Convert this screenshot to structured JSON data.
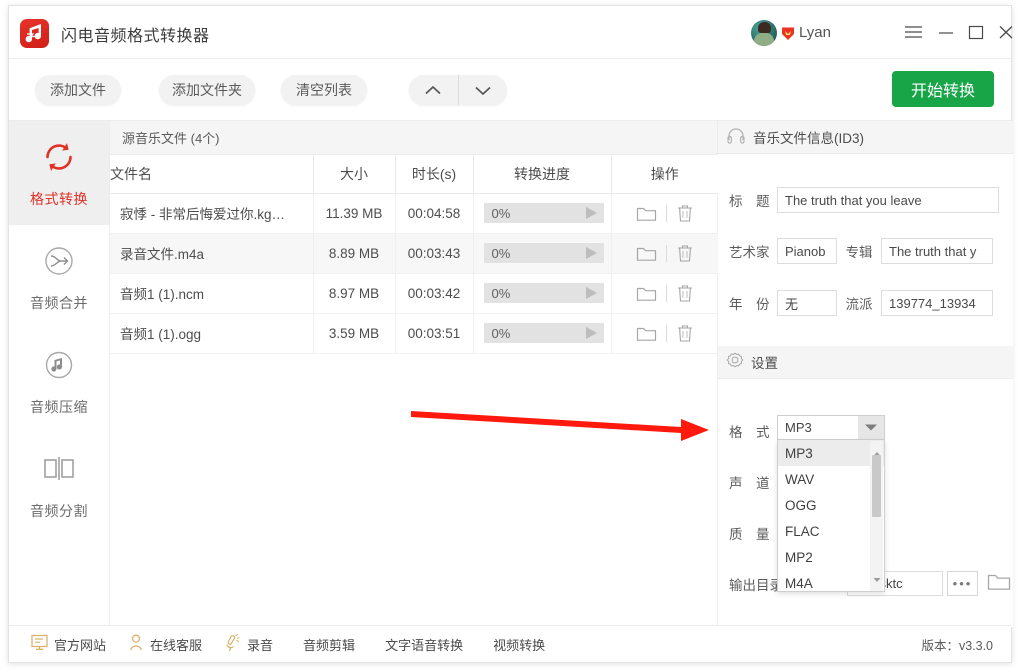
{
  "window": {
    "app_title": "闪电音频格式转换器",
    "app_icon": "music-note-icon",
    "user_name": "Lyan",
    "controls": {
      "menu": "menu-icon",
      "minimize": "minimize-icon",
      "maximize": "maximize-icon",
      "close": "close-icon"
    }
  },
  "toolbar": {
    "add_file": "添加文件",
    "add_folder": "添加文件夹",
    "clear_list": "清空列表",
    "move_up": "chevron-up-icon",
    "move_down": "chevron-down-icon",
    "start_convert": "开始转换",
    "start_convert_color": "#17a548"
  },
  "sidebar": {
    "items": [
      {
        "label": "格式转换",
        "icon": "refresh-circle-icon",
        "active": true
      },
      {
        "label": "音频合并",
        "icon": "merge-icon",
        "active": false
      },
      {
        "label": "音频压缩",
        "icon": "compress-note-icon",
        "active": false
      },
      {
        "label": "音频分割",
        "icon": "split-icon",
        "active": false
      }
    ],
    "active_color": "#e03127"
  },
  "filelist": {
    "header": "源音乐文件 (4个)",
    "columns": [
      "文件名",
      "大小",
      "时长(s)",
      "转换进度",
      "操作"
    ],
    "rows": [
      {
        "name": "寂悸 - 非常后悔爱过你.kg…",
        "size": "11.39 MB",
        "duration": "00:04:58",
        "progress": "0%"
      },
      {
        "name": "录音文件.m4a",
        "size": "8.89 MB",
        "duration": "00:03:43",
        "progress": "0%"
      },
      {
        "name": "音频1 (1).ncm",
        "size": "8.97 MB",
        "duration": "00:03:42",
        "progress": "0%"
      },
      {
        "name": "音频1 (1).ogg",
        "size": "3.59 MB",
        "duration": "00:03:51",
        "progress": "0%"
      }
    ],
    "row_action_icons": [
      "folder-icon",
      "trash-icon"
    ],
    "play_icon": "play-icon"
  },
  "id3": {
    "panel_title": "音乐文件信息(ID3)",
    "panel_icon": "headphones-icon",
    "title_label": "标　题",
    "title_value": "The truth that you leave",
    "artist_label": "艺术家",
    "artist_value": "Pianob",
    "album_label": "专辑",
    "album_value": "The truth that y",
    "year_label": "年　份",
    "year_value": "无",
    "genre_label": "流派",
    "genre_value": "139774_13934"
  },
  "settings": {
    "panel_title": "设置",
    "panel_icon": "gear-icon",
    "format_label": "格　式",
    "format_value": "MP3",
    "format_options": [
      "MP3",
      "WAV",
      "OGG",
      "FLAC",
      "MP2",
      "M4A"
    ],
    "format_selected": "MP3",
    "channel_label": "声　道",
    "quality_label": "质　量",
    "outdir_label": "输出目录",
    "outdir_value": "n\\Desktc",
    "browse_button": "•••",
    "open_folder_icon": "folder-icon"
  },
  "annotation": {
    "arrow_color": "#ff1a0d",
    "points_to": "格式"
  },
  "bottombar": {
    "items": [
      {
        "label": "官方网站",
        "icon": "monitor-icon"
      },
      {
        "label": "在线客服",
        "icon": "person-icon"
      },
      {
        "label": "录音",
        "icon": "mic-icon"
      },
      {
        "label": "音频剪辑",
        "icon": ""
      },
      {
        "label": "文字语音转换",
        "icon": ""
      },
      {
        "label": "视频转换",
        "icon": ""
      }
    ],
    "version": "版本：v3.3.0"
  }
}
